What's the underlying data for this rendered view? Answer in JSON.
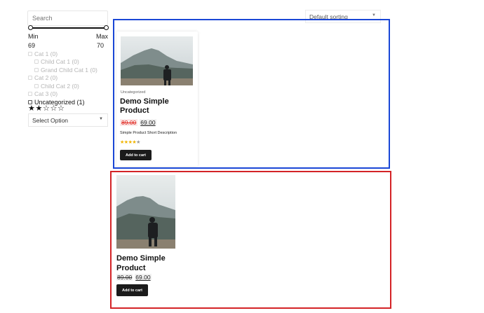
{
  "filters": {
    "search_placeholder": "Search",
    "price_range": {
      "min_label": "Min",
      "max_label": "Max",
      "min_value": "69",
      "max_value": "70"
    },
    "categories": [
      {
        "label": "Cat 1 (0)",
        "level": 0,
        "active": false
      },
      {
        "label": "Child Cat 1 (0)",
        "level": 1,
        "active": false
      },
      {
        "label": "Grand Child Cat 1 (0)",
        "level": 1,
        "active": false
      },
      {
        "label": "Cat 2 (0)",
        "level": 0,
        "active": false
      },
      {
        "label": "Child Cat 2 (0)",
        "level": 1,
        "active": false
      },
      {
        "label": "Cat 3 (0)",
        "level": 0,
        "active": false
      },
      {
        "label": "Uncategorized (1)",
        "level": 0,
        "active": true
      }
    ],
    "rating_filter": {
      "filled": 2,
      "total": 5
    },
    "select_label": "Select Option"
  },
  "sorting": {
    "label": "Default sorting"
  },
  "product_card_styled": {
    "category": "Uncategorized",
    "title": "Demo Simple Product",
    "regular_price": "89.00",
    "sale_price": "69.00",
    "short_description": "Simple Product Short Description",
    "rating": {
      "value": 4,
      "max": 5
    },
    "button_label": "Add to cart"
  },
  "product_card_plain": {
    "title": "Demo Simple Product",
    "regular_price": "89.00",
    "sale_price": "69.00",
    "button_label": "Add to cart"
  },
  "colors": {
    "blue_frame": "#1a47d6",
    "red_frame": "#d42326",
    "button_bg": "#1b1b1b",
    "star_color": "#f0b400",
    "regular_price_color": "#e0261e"
  }
}
